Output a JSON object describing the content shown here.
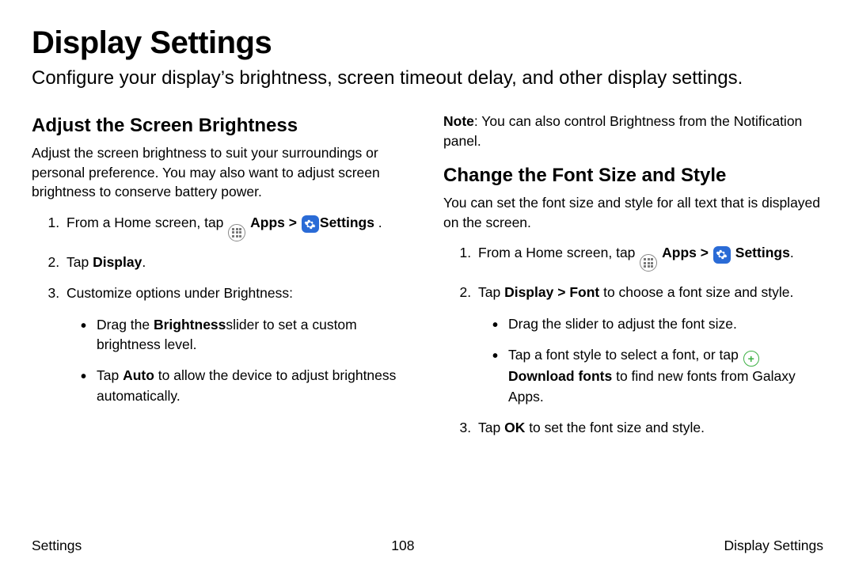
{
  "title": "Display Settings",
  "intro": "Configure your display’s brightness, screen timeout delay, and other display settings.",
  "breadcrumb": {
    "chevron": ">"
  },
  "icons": {
    "apps_label": "Apps",
    "settings_label": "Settings",
    "download_fonts_label": "Download fonts"
  },
  "left": {
    "heading": "Adjust the Screen Brightness",
    "para": "Adjust the screen brightness to suit your surroundings or personal preference. You may also want to adjust screen brightness to conserve battery power.",
    "steps": {
      "s1_prefix": "From a Home screen, tap ",
      "s1_suffix": " .",
      "s2_a": "Tap ",
      "s2_b": "Display",
      "s2_c": ".",
      "s3": "Customize options under Brightness:",
      "b1_a": "Drag the ",
      "b1_b": "Brightness",
      "b1_c": "slider  to set a custom brightness level.",
      "b2_a": "Tap ",
      "b2_b": "Auto",
      "b2_c": " to allow the device to adjust brightness automatically."
    }
  },
  "right": {
    "note_a": "Note",
    "note_b": ": You can also control Brightness from the Notification panel.",
    "heading": "Change the Font Size and Style",
    "para": "You can set the font size and style for all text that is displayed on the screen.",
    "steps": {
      "s1_prefix": "From a Home screen, tap ",
      "s1_suffix": ".",
      "s2_a": "Tap ",
      "s2_b": "Display",
      "s2_c": "Font",
      "s2_d": " to choose a font size and style.",
      "b1": "Drag the slider to adjust the font size.",
      "b2_a": "Tap a font style to select a font, or tap ",
      "b2_c": " to find new fonts from Galaxy Apps.",
      "s3_a": "Tap ",
      "s3_b": "OK",
      "s3_c": " to set the font size and style."
    }
  },
  "footer": {
    "left": "Settings",
    "center": "108",
    "right": "Display Settings"
  }
}
